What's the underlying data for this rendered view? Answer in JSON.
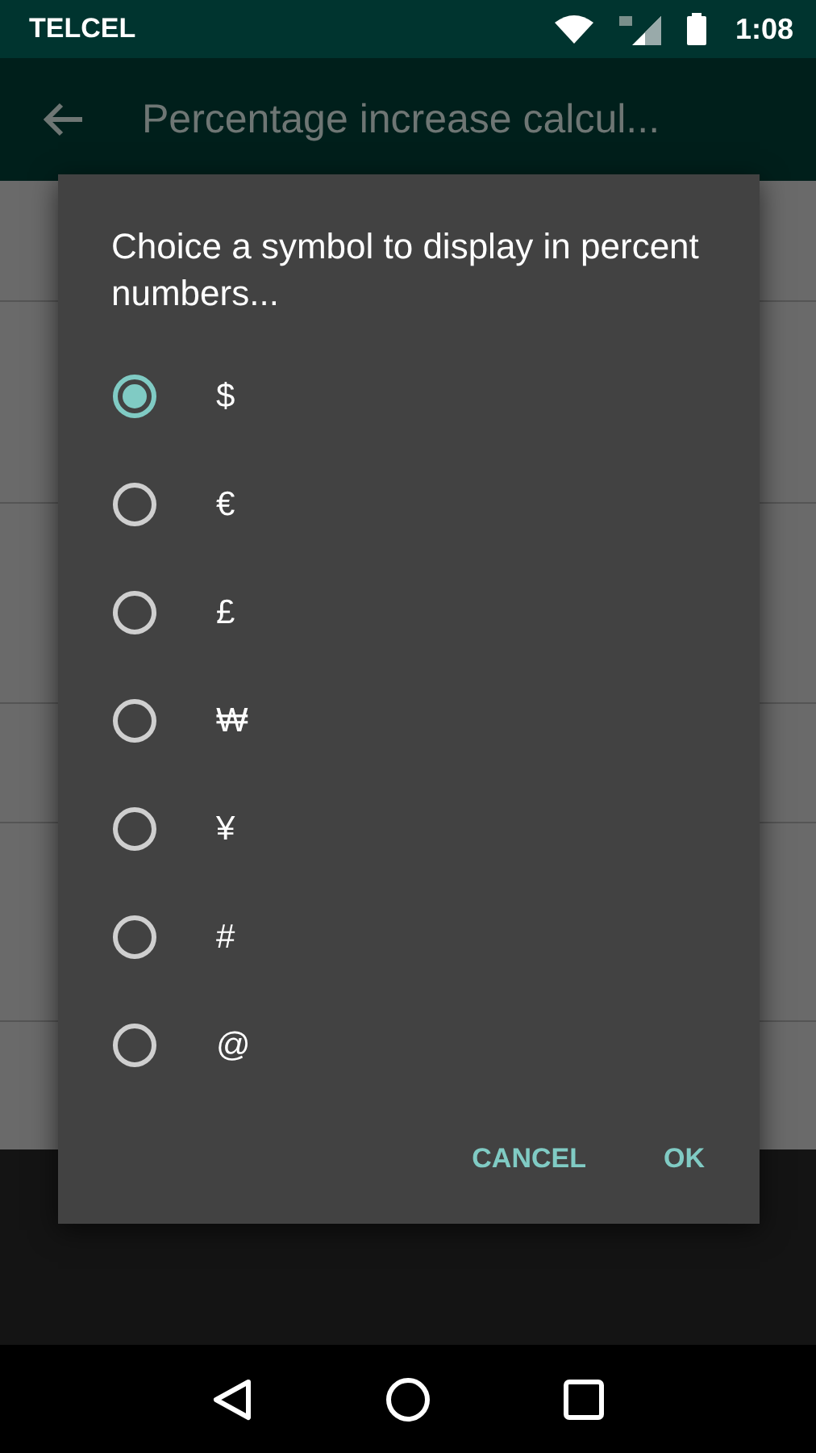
{
  "status_bar": {
    "carrier": "TELCEL",
    "time": "1:08"
  },
  "app_bar": {
    "title": "Percentage increase calcul..."
  },
  "dialog": {
    "title": "Choice a symbol to display in percent numbers...",
    "options": [
      {
        "label": "$",
        "selected": true
      },
      {
        "label": "€",
        "selected": false
      },
      {
        "label": "£",
        "selected": false
      },
      {
        "label": "₩",
        "selected": false
      },
      {
        "label": "¥",
        "selected": false
      },
      {
        "label": "#",
        "selected": false
      },
      {
        "label": "@",
        "selected": false
      }
    ],
    "buttons": [
      "CANCEL",
      "OK"
    ]
  }
}
